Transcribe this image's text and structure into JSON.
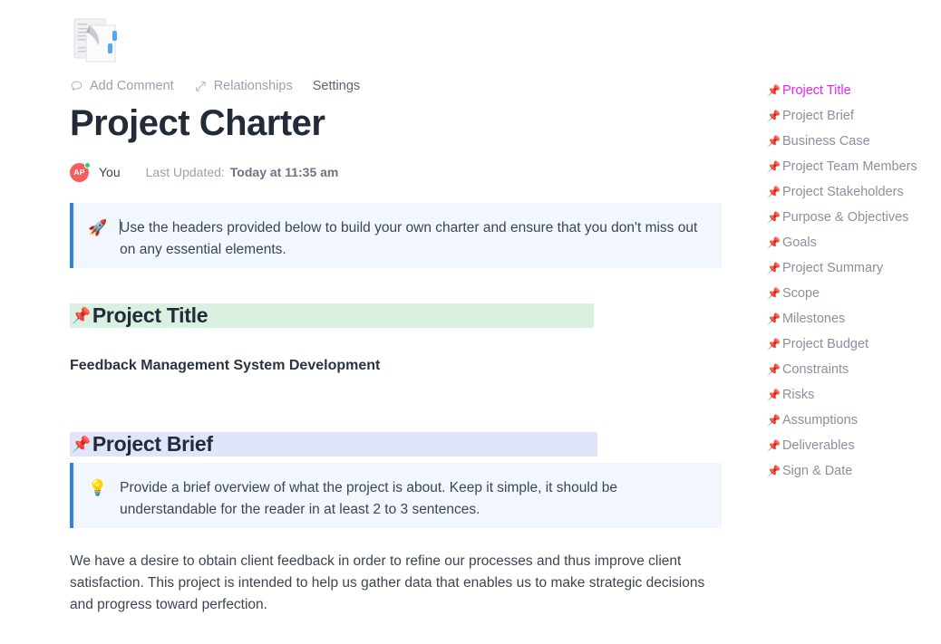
{
  "document_icon": {
    "name": "document-pages-icon"
  },
  "toolbar": {
    "add_comment": {
      "label": "Add Comment",
      "icon": "comment-bubble-icon"
    },
    "relationships": {
      "label": "Relationships",
      "icon": "relationships-icon"
    },
    "settings": {
      "label": "Settings"
    }
  },
  "header": {
    "title": "Project Charter"
  },
  "meta": {
    "avatar_initials": "AP",
    "user": "You",
    "updated_label": "Last Updated:",
    "updated_value": "Today at 11:35 am",
    "presence": "online"
  },
  "callouts": {
    "rocket": {
      "emoji": "🚀",
      "icon": "rocket-emoji",
      "text": "Use the headers provided below to build your own charter and ensure that you don't miss out on any essential elements."
    },
    "bulb": {
      "emoji": "💡",
      "icon": "lightbulb-emoji",
      "text": "Provide a brief overview of what the project is about. Keep it simple, it should be understandable for the reader in at least 2 to 3 sentences."
    }
  },
  "sections": {
    "project_title": {
      "pin": "📌",
      "heading": "Project Title",
      "value": "Feedback Management System Development",
      "highlight": "#daf0e1"
    },
    "project_brief": {
      "pin": "📌",
      "heading": "Project Brief",
      "body": "We have a desire to obtain client feedback in order to refine our processes and thus improve client satisfaction. This project is intended to help us gather data that enables us to make strategic decisions and progress toward perfection.",
      "highlight": "#e0e5fc"
    }
  },
  "outline": {
    "active_color": "#ef22ef",
    "inactive_color": "#8a919d",
    "pin": "📌",
    "items": [
      {
        "label": "Project Title",
        "active": true
      },
      {
        "label": "Project Brief",
        "active": false
      },
      {
        "label": "Business Case",
        "active": false
      },
      {
        "label": "Project Team Members",
        "active": false
      },
      {
        "label": "Project Stakeholders",
        "active": false
      },
      {
        "label": "Purpose & Objectives",
        "active": false
      },
      {
        "label": "Goals",
        "active": false
      },
      {
        "label": "Project Summary",
        "active": false
      },
      {
        "label": "Scope",
        "active": false
      },
      {
        "label": "Milestones",
        "active": false
      },
      {
        "label": "Project Budget",
        "active": false
      },
      {
        "label": "Constraints",
        "active": false
      },
      {
        "label": "Risks",
        "active": false
      },
      {
        "label": "Assumptions",
        "active": false
      },
      {
        "label": "Deliverables",
        "active": false
      },
      {
        "label": "Sign & Date",
        "active": false
      }
    ]
  }
}
